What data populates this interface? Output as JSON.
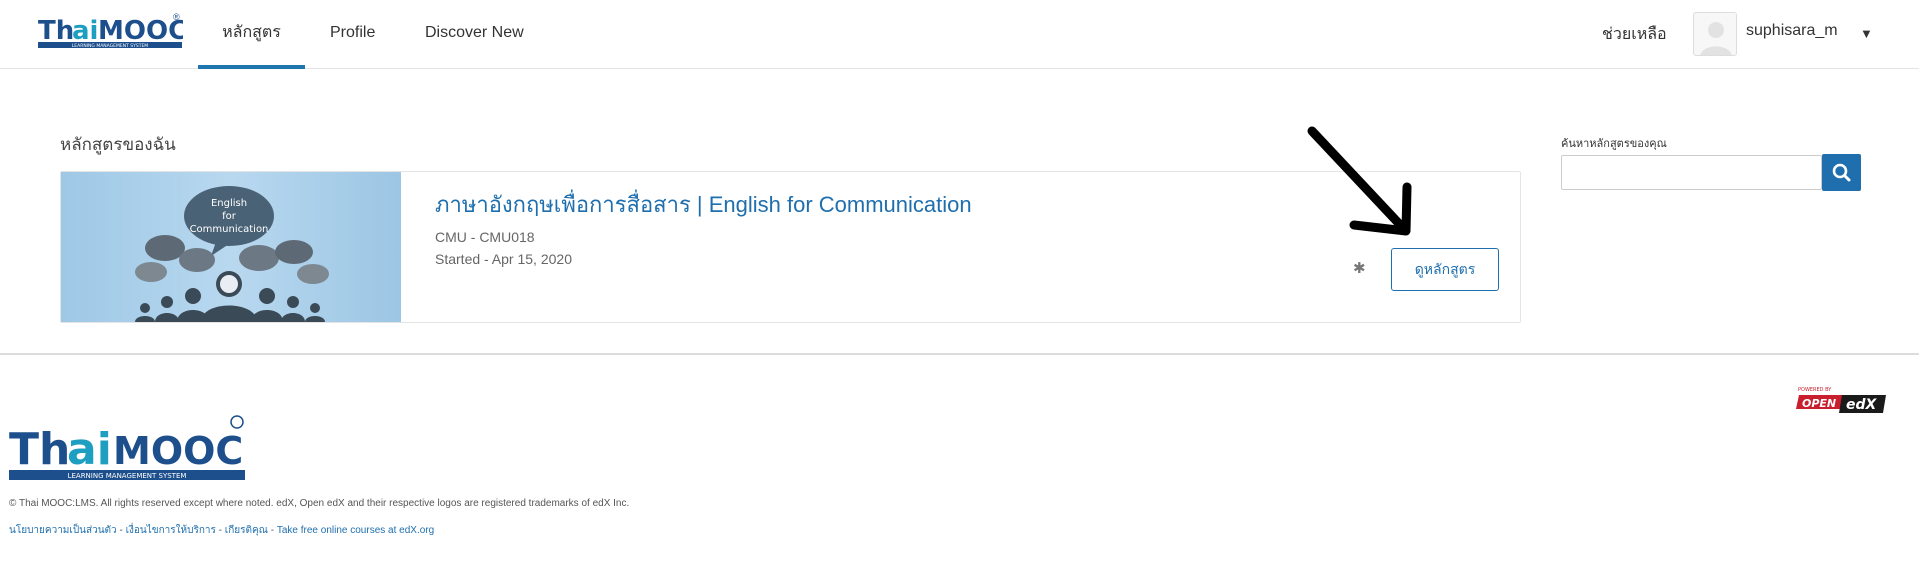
{
  "header": {
    "nav": [
      {
        "label": "หลักสูตร",
        "active": true
      },
      {
        "label": "Profile",
        "active": false
      },
      {
        "label": "Discover New",
        "active": false
      }
    ],
    "help_label": "ช่วยเหลือ",
    "username": "suphisara_m"
  },
  "main": {
    "section_title": "หลักสูตรของฉัน",
    "course": {
      "thumbnail_text": [
        "English",
        "for",
        "Communication"
      ],
      "title": "ภาษาอังกฤษเพื่อการสื่อสาร | English for Communication",
      "code": "CMU - CMU018",
      "started": "Started - Apr 15, 2020",
      "view_button": "ดูหลักสูตร"
    },
    "search": {
      "label": "ค้นหาหลักสูตรของคุณ",
      "placeholder": "",
      "value": ""
    }
  },
  "footer": {
    "copyright": "© Thai MOOC:LMS. All rights reserved except where noted. edX, Open edX and their respective logos are registered trademarks of edX Inc.",
    "links": [
      "นโยบายความเป็นส่วนตัว",
      "เงื่อนไขการให้บริการ",
      "เกียรติคุณ",
      "Take free online courses at edX.org"
    ],
    "separator": "-"
  },
  "logo": {
    "text": "ThaiMOOC",
    "subtitle": "LEARNING MANAGEMENT SYSTEM",
    "mark": "®"
  },
  "powered": {
    "small": "POWERED BY",
    "open": "OPEN",
    "edx": "edX"
  },
  "colors": {
    "accent": "#1f6fae",
    "logo_blue": "#1d4f8c",
    "logo_teal": "#1e9ec1",
    "openedx_red": "#c81e2d"
  }
}
